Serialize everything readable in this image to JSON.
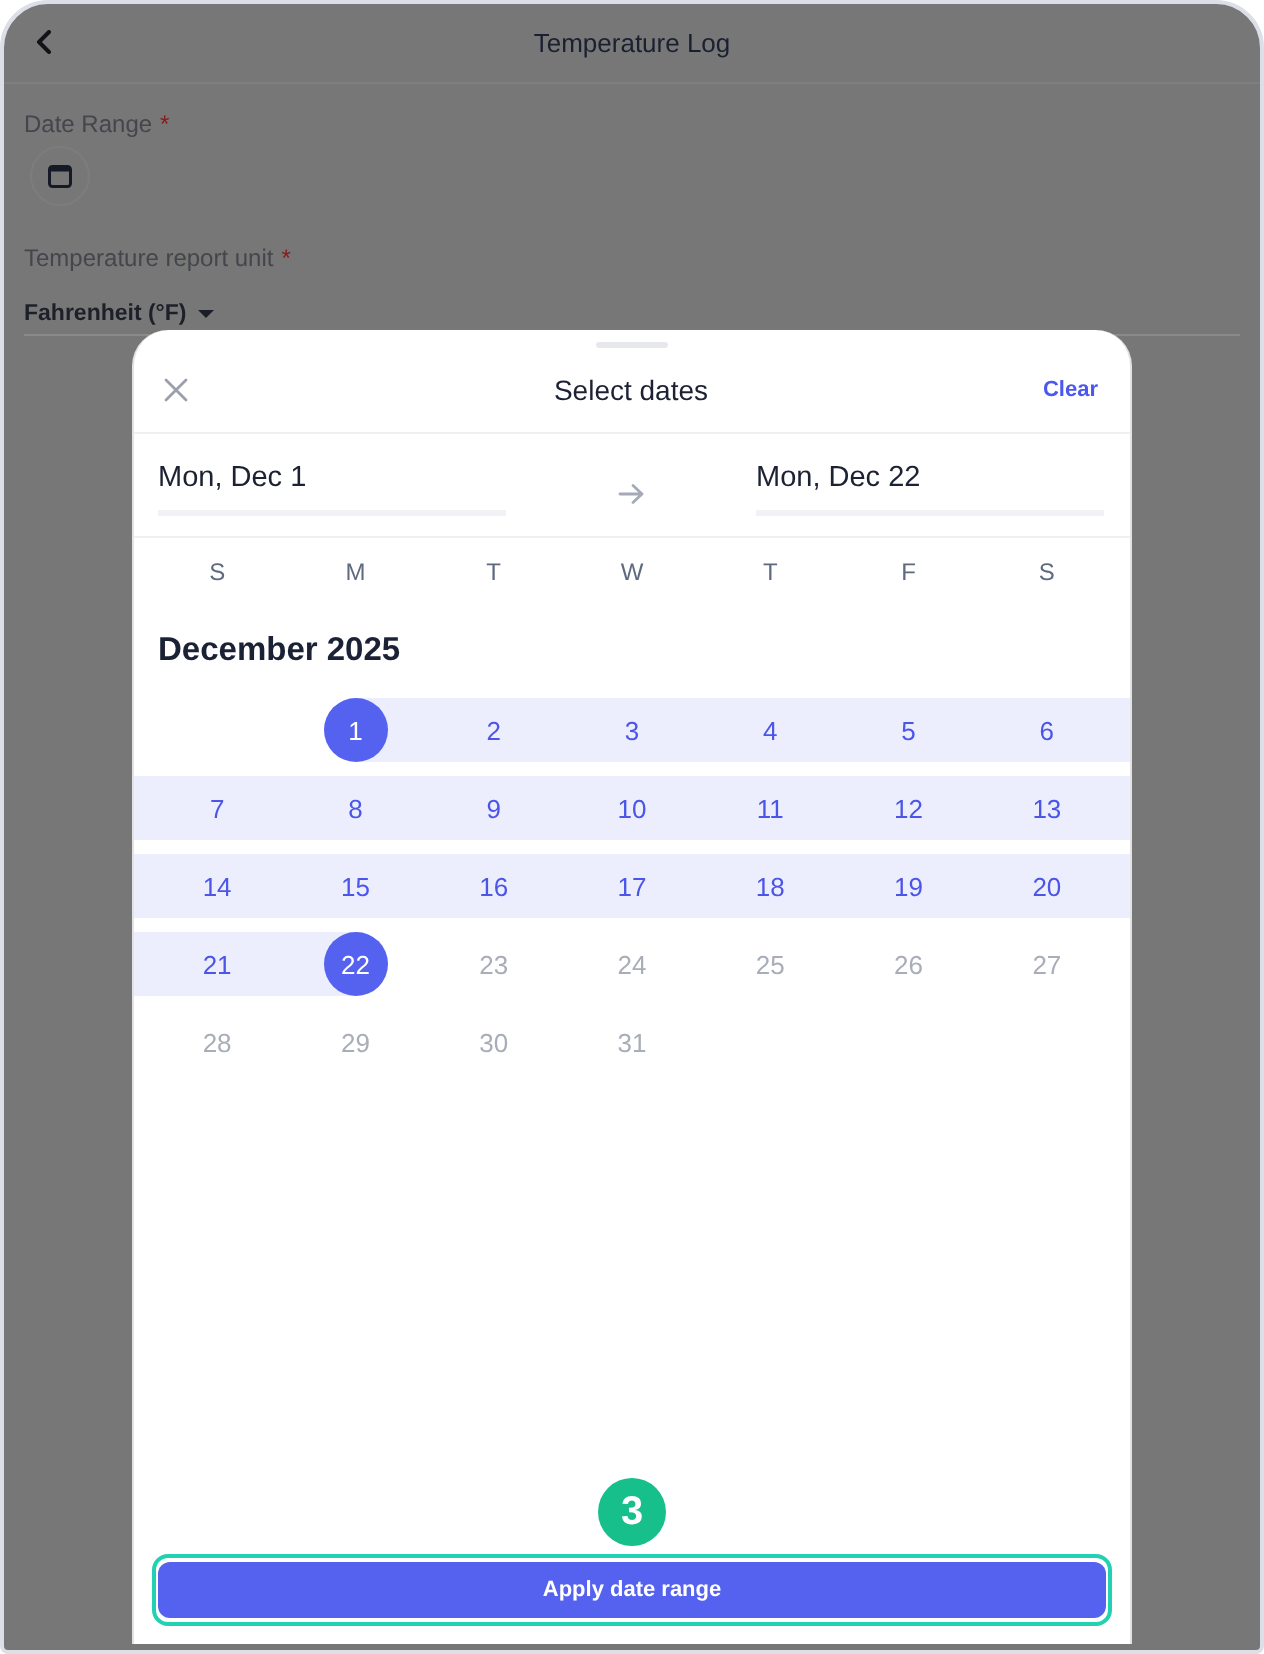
{
  "app_bar": {
    "title": "Temperature Log"
  },
  "form": {
    "date_range": {
      "label": "Date Range",
      "required_mark": "*"
    },
    "unit": {
      "label": "Temperature report unit",
      "required_mark": "*",
      "value": "Fahrenheit (°F)"
    }
  },
  "sheet": {
    "title": "Select dates",
    "clear": "Clear",
    "start_date": "Mon, Dec 1",
    "end_date": "Mon, Dec 22",
    "weekdays": [
      "S",
      "M",
      "T",
      "W",
      "T",
      "F",
      "S"
    ],
    "month": "December 2025",
    "weeks": [
      {
        "days": [
          {
            "label": "1",
            "selected": true,
            "in_range": false,
            "disabled": false
          },
          {
            "label": "2",
            "selected": false,
            "in_range": true,
            "disabled": false
          },
          {
            "label": "3",
            "selected": false,
            "in_range": true,
            "disabled": false
          },
          {
            "label": "4",
            "selected": false,
            "in_range": true,
            "disabled": false
          },
          {
            "label": "5",
            "selected": false,
            "in_range": true,
            "disabled": false
          },
          {
            "label": "6",
            "selected": false,
            "in_range": true,
            "disabled": false
          }
        ]
      },
      {
        "days": [
          {
            "label": "7",
            "selected": false,
            "in_range": true,
            "disabled": false
          },
          {
            "label": "8",
            "selected": false,
            "in_range": true,
            "disabled": false
          },
          {
            "label": "9",
            "selected": false,
            "in_range": true,
            "disabled": false
          },
          {
            "label": "10",
            "selected": false,
            "in_range": true,
            "disabled": false
          },
          {
            "label": "11",
            "selected": false,
            "in_range": true,
            "disabled": false
          },
          {
            "label": "12",
            "selected": false,
            "in_range": true,
            "disabled": false
          },
          {
            "label": "13",
            "selected": false,
            "in_range": true,
            "disabled": false
          }
        ]
      },
      {
        "days": [
          {
            "label": "14",
            "selected": false,
            "in_range": true,
            "disabled": false
          },
          {
            "label": "15",
            "selected": false,
            "in_range": true,
            "disabled": false
          },
          {
            "label": "16",
            "selected": false,
            "in_range": true,
            "disabled": false
          },
          {
            "label": "17",
            "selected": false,
            "in_range": true,
            "disabled": false
          },
          {
            "label": "18",
            "selected": false,
            "in_range": true,
            "disabled": false
          },
          {
            "label": "19",
            "selected": false,
            "in_range": true,
            "disabled": false
          },
          {
            "label": "20",
            "selected": false,
            "in_range": true,
            "disabled": false
          }
        ]
      },
      {
        "days": [
          {
            "label": "21",
            "selected": false,
            "in_range": true,
            "disabled": false
          },
          {
            "label": "22",
            "selected": true,
            "in_range": false,
            "disabled": false
          },
          {
            "label": "23",
            "selected": false,
            "in_range": false,
            "disabled": true
          },
          {
            "label": "24",
            "selected": false,
            "in_range": false,
            "disabled": true
          },
          {
            "label": "25",
            "selected": false,
            "in_range": false,
            "disabled": true
          },
          {
            "label": "26",
            "selected": false,
            "in_range": false,
            "disabled": true
          },
          {
            "label": "27",
            "selected": false,
            "in_range": false,
            "disabled": true
          }
        ]
      },
      {
        "days": [
          {
            "label": "28",
            "selected": false,
            "in_range": false,
            "disabled": true
          },
          {
            "label": "29",
            "selected": false,
            "in_range": false,
            "disabled": true
          },
          {
            "label": "30",
            "selected": false,
            "in_range": false,
            "disabled": true
          },
          {
            "label": "31",
            "selected": false,
            "in_range": false,
            "disabled": true
          }
        ]
      }
    ],
    "step_badge": "3",
    "apply": "Apply date range"
  }
}
